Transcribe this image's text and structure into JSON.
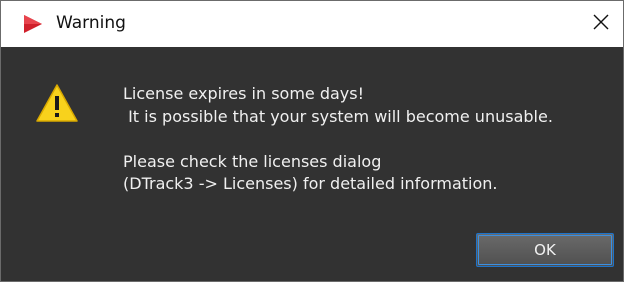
{
  "window": {
    "title": "Warning",
    "app_icon": "red-play-triangle-icon",
    "close_icon": "close-icon"
  },
  "dialog": {
    "icon": "warning-triangle-icon",
    "message_lines": [
      "License expires in some days!",
      " It is possible that your system will become unusable.",
      "",
      "Please check the licenses dialog",
      "(DTrack3 -> Licenses) for detailed information."
    ],
    "ok_label": "OK"
  },
  "colors": {
    "app_icon": "#d0202b",
    "warning_yellow": "#f8d21c",
    "button_focus_border": "#1e73c9",
    "dialog_background": "#323232"
  }
}
